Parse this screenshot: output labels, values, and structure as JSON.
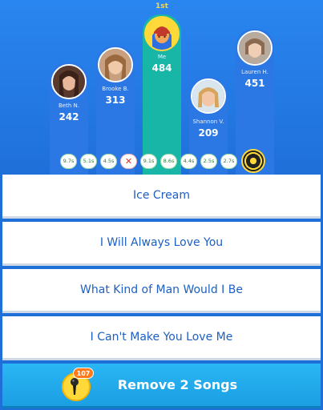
{
  "leaderboard": {
    "first_label": "1st",
    "players": [
      {
        "name": "Beth N.",
        "score": "242",
        "avatar": "woman-photo-avatar"
      },
      {
        "name": "Brooke B.",
        "score": "313",
        "avatar": "woman-photo-avatar"
      },
      {
        "name": "Me",
        "score": "484",
        "avatar": "cartoon-player-avatar"
      },
      {
        "name": "Shannon V.",
        "score": "209",
        "avatar": "woman-photo-avatar"
      },
      {
        "name": "Lauren H.",
        "score": "451",
        "avatar": "woman-photo-avatar"
      }
    ]
  },
  "timeline": {
    "items": [
      "9.7s",
      "5.1s",
      "4.5s",
      "✕",
      "9.1s",
      "8.6s",
      "4.4s",
      "2.5s",
      "2.7s"
    ]
  },
  "answers": [
    "Ice Cream",
    "I Will Always Love You",
    "What Kind of Man Would I Be",
    "I Can't Make You Love Me"
  ],
  "powerup": {
    "label": "Remove 2 Songs",
    "count": "107",
    "icon": "microphone-icon"
  },
  "colors": {
    "background": "#1f6fd9",
    "leader_pillar": "#17b6a6",
    "pillar": "#2b78e4",
    "answer_text": "#1d5fc2",
    "powerup_bg": "#1b9fe3",
    "badge": "#ff7a1a"
  }
}
